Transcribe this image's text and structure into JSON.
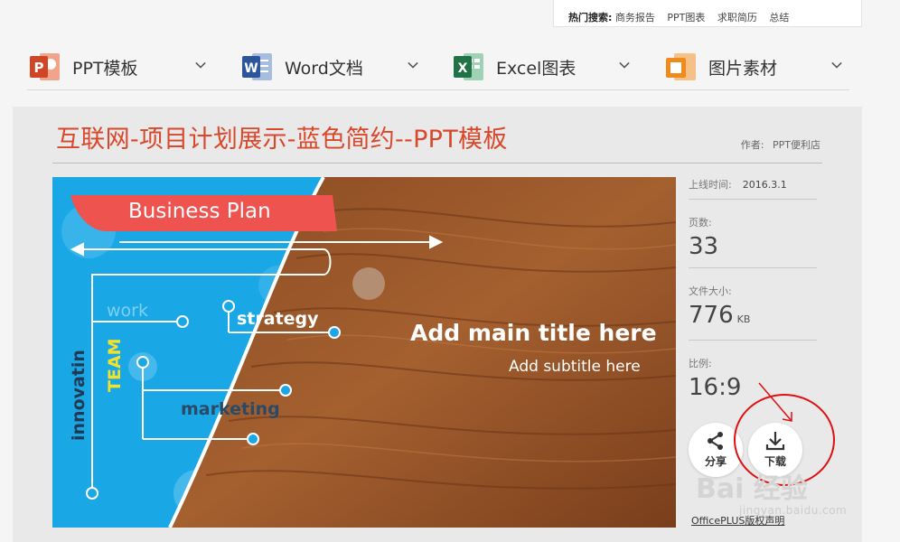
{
  "hot_search": {
    "label": "热门搜索:",
    "links": [
      "商务报告",
      "PPT图表",
      "求职简历",
      "总结"
    ]
  },
  "nav": {
    "categories": [
      {
        "label": "PPT模板",
        "icon": "powerpoint-icon",
        "icon_letter": "P",
        "color": "#d04525"
      },
      {
        "label": "Word文档",
        "icon": "word-icon",
        "icon_letter": "W",
        "color": "#2b579a"
      },
      {
        "label": "Excel图表",
        "icon": "excel-icon",
        "icon_letter": "X",
        "color": "#217346"
      },
      {
        "label": "图片素材",
        "icon": "image-icon",
        "color": "#ef8a1d"
      }
    ]
  },
  "template": {
    "title": "互联网-项目计划展示-蓝色简约--PPT模板",
    "author_label": "作者:",
    "author": "PPT便利店"
  },
  "slide": {
    "badge": "Business Plan",
    "work": "work",
    "strategy": "strategy",
    "marketing": "marketing",
    "team": "TEAM",
    "innovatin": "innovatin",
    "main_title": "Add main title here",
    "subtitle": "Add subtitle here"
  },
  "info": {
    "online_label": "上线时间:",
    "online_value": "2016.3.1",
    "pages_label": "页数:",
    "pages_value": "33",
    "size_label": "文件大小:",
    "size_value": "776",
    "size_unit": "KB",
    "ratio_label": "比例:",
    "ratio_value": "16:9"
  },
  "actions": {
    "share": "分享",
    "download": "下载"
  },
  "license_link": "OfficePLUS版权声明",
  "watermark": {
    "logo": "Bai 经验",
    "url": "jingyan.baidu.com"
  },
  "colors": {
    "accent_red": "#d9482b",
    "slide_blue": "#1aa7e6",
    "annotation_red": "#e01010"
  }
}
